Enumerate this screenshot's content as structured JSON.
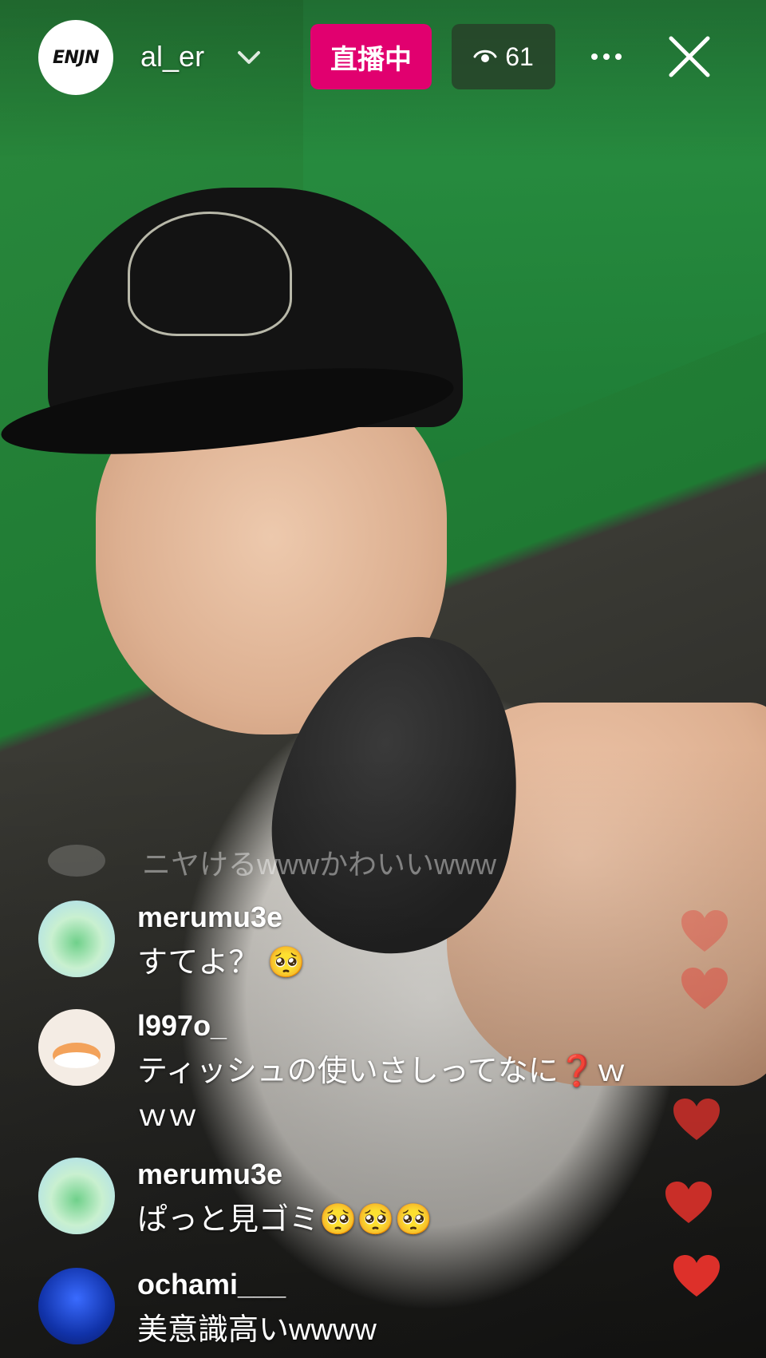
{
  "header": {
    "channel_logo_text": "ENJN",
    "username": "al_er",
    "live_label": "直播中",
    "viewer_count": "61"
  },
  "ghost_comment": {
    "text": "ニヤけるwwwかわいいwww"
  },
  "comments": [
    {
      "user": "merumu3e",
      "text": "すてよ？ 🥺"
    },
    {
      "user": "l997o_",
      "text": "ティッシュの使いさしってなに❓ｗｗｗ"
    },
    {
      "user": "merumu3e",
      "text": "ぱっと見ゴミ🥺🥺🥺"
    },
    {
      "user": "ochami___",
      "text": "美意識高いwwww"
    }
  ],
  "colors": {
    "live_badge": "#e1006f",
    "heart": "#e8322c"
  },
  "icons": {
    "more": "more-icon",
    "close": "close-icon",
    "eye": "eye-icon",
    "chevron": "chevron-down-icon"
  }
}
